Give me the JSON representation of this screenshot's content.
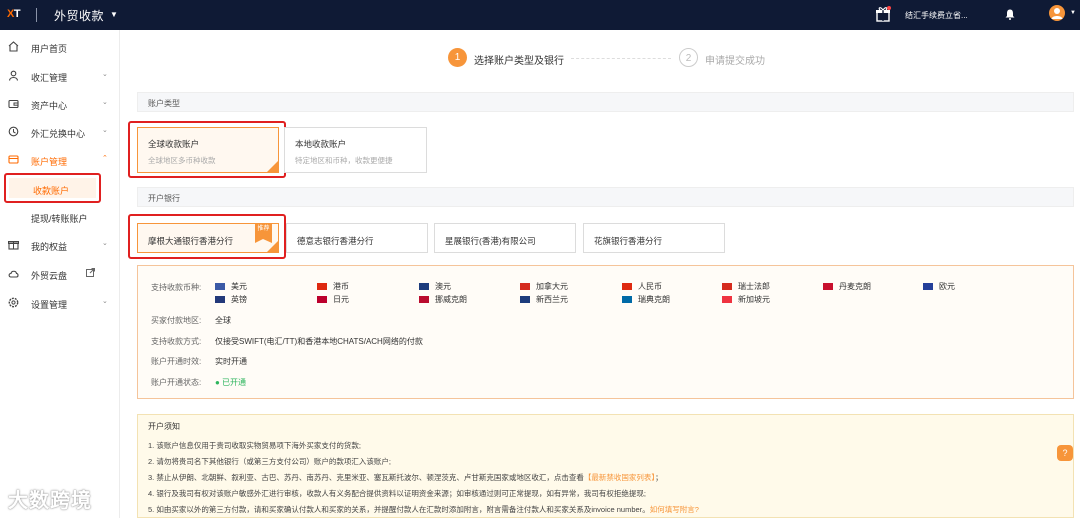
{
  "topbar": {
    "logo_x": "X",
    "logo_t": "T",
    "app_title": "外贸收款",
    "company": "结汇手续费立省..."
  },
  "sidebar": {
    "items": [
      {
        "label": "用户首页",
        "icon": "home-icon"
      },
      {
        "label": "收汇管理",
        "icon": "user-icon"
      },
      {
        "label": "资产中心",
        "icon": "wallet-icon"
      },
      {
        "label": "外汇兑换中心",
        "icon": "exchange-icon"
      },
      {
        "label": "账户管理",
        "icon": "account-icon"
      },
      {
        "label": "收款账户"
      },
      {
        "label": "提现/转账账户"
      },
      {
        "label": "我的权益",
        "icon": "gift-icon"
      },
      {
        "label": "外贸云盘",
        "icon": "cloud-icon"
      },
      {
        "label": "设置管理",
        "icon": "settings-icon"
      }
    ]
  },
  "steps": [
    {
      "num": "1",
      "label": "选择账户类型及银行"
    },
    {
      "num": "2",
      "label": "申请提交成功"
    }
  ],
  "account_type": {
    "section_title": "账户类型",
    "options": [
      {
        "title": "全球收款账户",
        "desc": "全球地区多币种收款"
      },
      {
        "title": "本地收款账户",
        "desc": "特定地区和币种，收款更便捷"
      }
    ]
  },
  "bank": {
    "section_title": "开户银行",
    "badge": "推荐",
    "options": [
      {
        "title": "摩根大通银行香港分行"
      },
      {
        "title": "德意志银行香港分行"
      },
      {
        "title": "星展银行(香港)有限公司"
      },
      {
        "title": "花旗银行香港分行"
      }
    ]
  },
  "details": {
    "currency_label": "支持收款币种:",
    "currencies": [
      {
        "name": "美元",
        "color": "#3c5aa6"
      },
      {
        "name": "港币",
        "color": "#de2910"
      },
      {
        "name": "澳元",
        "color": "#1d3c7d"
      },
      {
        "name": "加拿大元",
        "color": "#d52b1e"
      },
      {
        "name": "人民币",
        "color": "#de2910"
      },
      {
        "name": "瑞士法郎",
        "color": "#d52b1e"
      },
      {
        "name": "丹麦克朗",
        "color": "#c8102e"
      },
      {
        "name": "欧元",
        "color": "#243f99"
      },
      {
        "name": "英镑",
        "color": "#23397a"
      },
      {
        "name": "日元",
        "color": "#bc002d"
      },
      {
        "name": "挪威克朗",
        "color": "#ba0c2f"
      },
      {
        "name": "新西兰元",
        "color": "#1d3c7d"
      },
      {
        "name": "瑞典克朗",
        "color": "#006aa7"
      },
      {
        "name": "新加坡元",
        "color": "#ef3340"
      }
    ],
    "payer_region_label": "买家付款地区:",
    "payer_region": "全球",
    "method_label": "支持收款方式:",
    "method": "仅接受SWIFT(电汇/TT)和香港本地CHATS/ACH网络的付款",
    "timing_label": "账户开通时效:",
    "timing": "实时开通",
    "status_label": "账户开通状态:",
    "status": "● 已开通"
  },
  "notice": {
    "title": "开户须知",
    "items": [
      "1. 该账户信息仅用于贵司收取实物贸易项下海外买家支付的货款;",
      "2. 请勿将贵司名下其他银行（或第三方支付公司）账户的款项汇入该账户;",
      "3. 禁止从伊朗、北朝鲜、叙利亚、古巴、苏丹、南苏丹、克里米亚、塞瓦斯托波尔、顿涅茨克、卢甘斯克国家或地区收汇，点击查看",
      "4. 银行及我司有权对该账户敏感外汇进行审核，收款人有义务配合提供资料以证明资金来源；如审核通过则可正常提现，如有异常，我司有权拒绝提现;",
      "5. 如由买家以外的第三方付款，请和买家确认付款人和买家的关系，并提醒付款人在汇款时添加附言，附言需备注付款人和买家关系及invoice number。"
    ],
    "link1": "【最新禁收国家列表】",
    "link1_suffix": "；",
    "link2": "如何填写附言?"
  },
  "help": "?",
  "watermark": "大数跨境"
}
